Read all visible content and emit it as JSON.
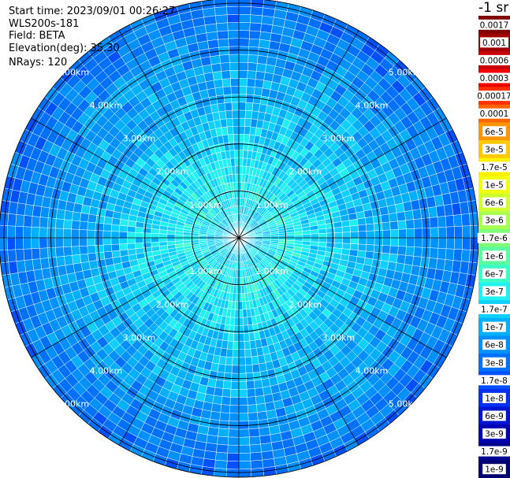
{
  "header": {
    "start_time": "Start time: 2023/09/01 00:26:27",
    "instrument": "WLS200s-181",
    "field": "Field: BETA",
    "elevation": "Elevation(deg): 35.30",
    "nrays": "NRays: 120"
  },
  "chart_data": {
    "type": "heatmap",
    "projection": "polar (PPI)",
    "field": "BETA",
    "unit_label": "-1 sr",
    "n_rays": 120,
    "range_rings_km": [
      1,
      2,
      3,
      4,
      5
    ],
    "range_labels": [
      "1.00km",
      "2.00km",
      "3.00km",
      "4.00km",
      "5.00km"
    ],
    "outer_range_km": 5.1,
    "radial_line_count": 12,
    "colorbar": {
      "scale": "log",
      "tick_labels": [
        "0.0017",
        "0.001",
        "0.0006",
        "0.0003",
        "0.00017",
        "0.0001",
        "6e-5",
        "3e-5",
        "1.7e-5",
        "1e-5",
        "6e-6",
        "3e-6",
        "1.7e-6",
        "1e-6",
        "6e-7",
        "3e-7",
        "1.7e-7",
        "1e-7",
        "6e-8",
        "3e-8",
        "1.7e-8",
        "1e-8",
        "6e-9",
        "3e-9",
        "1.7e-9",
        "1e-9"
      ],
      "colors": [
        "#7f0000",
        "#a00000",
        "#c80000",
        "#f00000",
        "#ff3000",
        "#ff6400",
        "#ff9600",
        "#ffc800",
        "#fff000",
        "#f0ff10",
        "#d0ff2e",
        "#a8ff50",
        "#80ff78",
        "#5cffa0",
        "#3effc8",
        "#20f0f0",
        "#10d0ff",
        "#00b0ff",
        "#0090ff",
        "#0070ff",
        "#0050ff",
        "#0030f0",
        "#0014d0",
        "#0000b0",
        "#000090",
        "#000070"
      ]
    },
    "typical_value_by_range": [
      {
        "range_km": 0.3,
        "value": "1.7e-7"
      },
      {
        "range_km": 1.0,
        "value": "3e-7"
      },
      {
        "range_km": 2.0,
        "value": "1.7e-7"
      },
      {
        "range_km": 3.0,
        "value": "1e-7"
      },
      {
        "range_km": 4.0,
        "value": "6e-8"
      },
      {
        "range_km": 5.0,
        "value": "3e-8"
      }
    ]
  }
}
